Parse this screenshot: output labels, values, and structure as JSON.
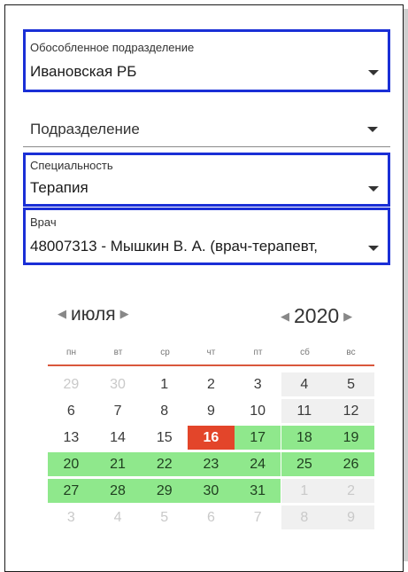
{
  "fields": {
    "division": {
      "label": "Обособленное подразделение",
      "value": "Ивановская РБ"
    },
    "department": {
      "placeholder": "Подразделение"
    },
    "specialty": {
      "label": "Специальность",
      "value": "Терапия"
    },
    "doctor": {
      "label": "Врач",
      "value": "48007313 - Мышкин В. А. (врач-терапевт,"
    }
  },
  "calendar": {
    "month": "июля",
    "year": "2020",
    "weekdays": [
      "пн",
      "вт",
      "ср",
      "чт",
      "пт",
      "сб",
      "вс"
    ],
    "weeks": [
      [
        "29",
        "30",
        "1",
        "2",
        "3",
        "4",
        "5"
      ],
      [
        "6",
        "7",
        "8",
        "9",
        "10",
        "11",
        "12"
      ],
      [
        "13",
        "14",
        "15",
        "16",
        "17",
        "18",
        "19"
      ],
      [
        "20",
        "21",
        "22",
        "23",
        "24",
        "25",
        "26"
      ],
      [
        "27",
        "28",
        "29",
        "30",
        "31",
        "1",
        "2"
      ],
      [
        "3",
        "4",
        "5",
        "6",
        "7",
        "8",
        "9"
      ]
    ],
    "today": "16",
    "colors": {
      "available": "#8fe88c",
      "today": "#e3452a",
      "weekend": "#f0f0f0",
      "accent_line": "#d9573c",
      "field_border": "#1a2fd6"
    }
  }
}
